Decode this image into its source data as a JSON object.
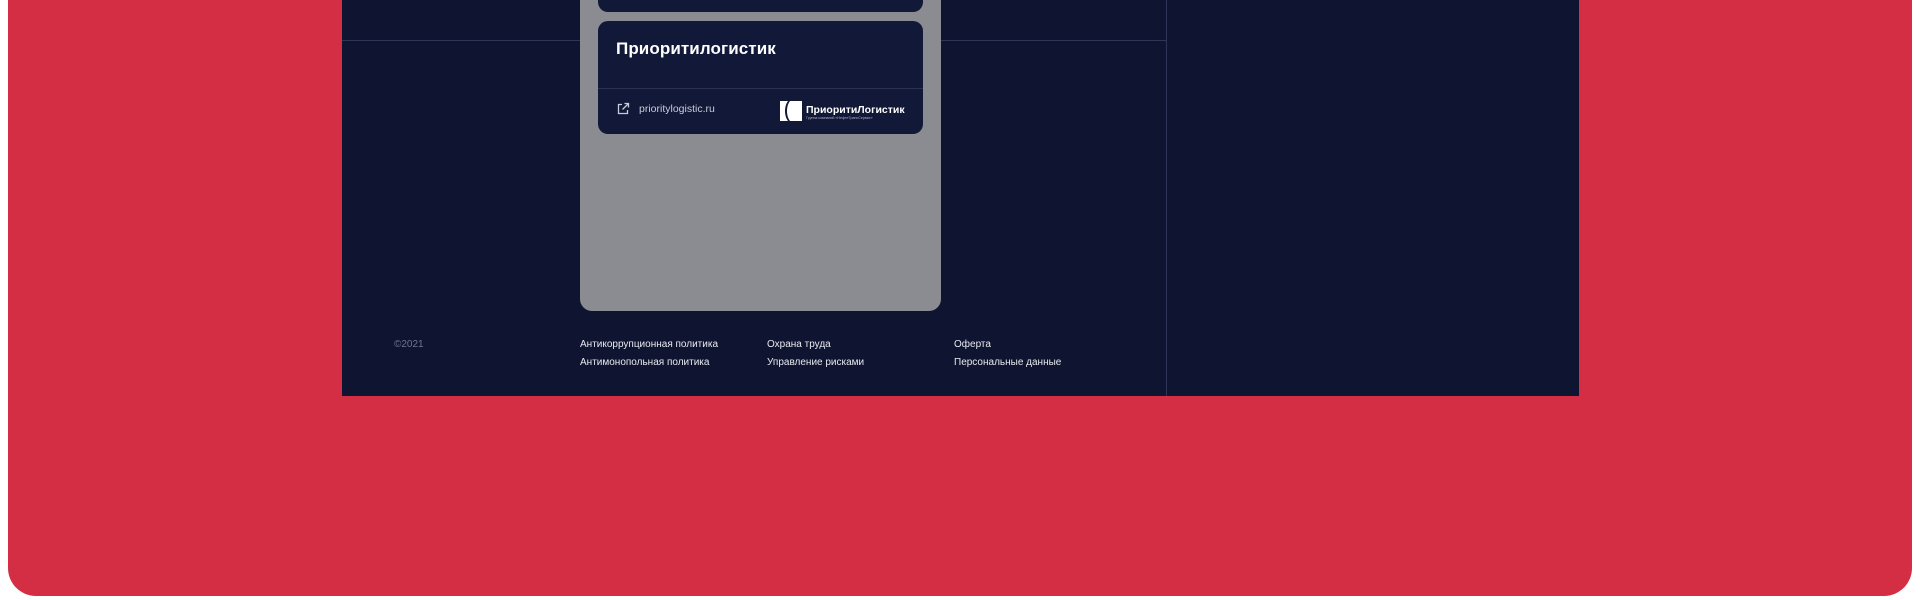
{
  "card": {
    "title": "Приоритилогистик",
    "link_text": "prioritylogistic.ru",
    "logo_name": "ПриоритиЛогистик",
    "logo_subtitle": "Группа компаний «НефтеТрансСервис»"
  },
  "footer": {
    "copyright": "©2021",
    "links": [
      "Антикоррупционная политика",
      "Антимонопольная политика",
      "Охрана труда",
      "Управление рисками",
      "Оферта",
      "Персональные данные"
    ]
  },
  "colors": {
    "page_red": "#d32e44",
    "navy": "#0f1430",
    "card": "#121838",
    "panel_gray": "#8a8c91"
  },
  "icons": {
    "link": "external-link-icon",
    "logo": "logo-mark-icon"
  }
}
